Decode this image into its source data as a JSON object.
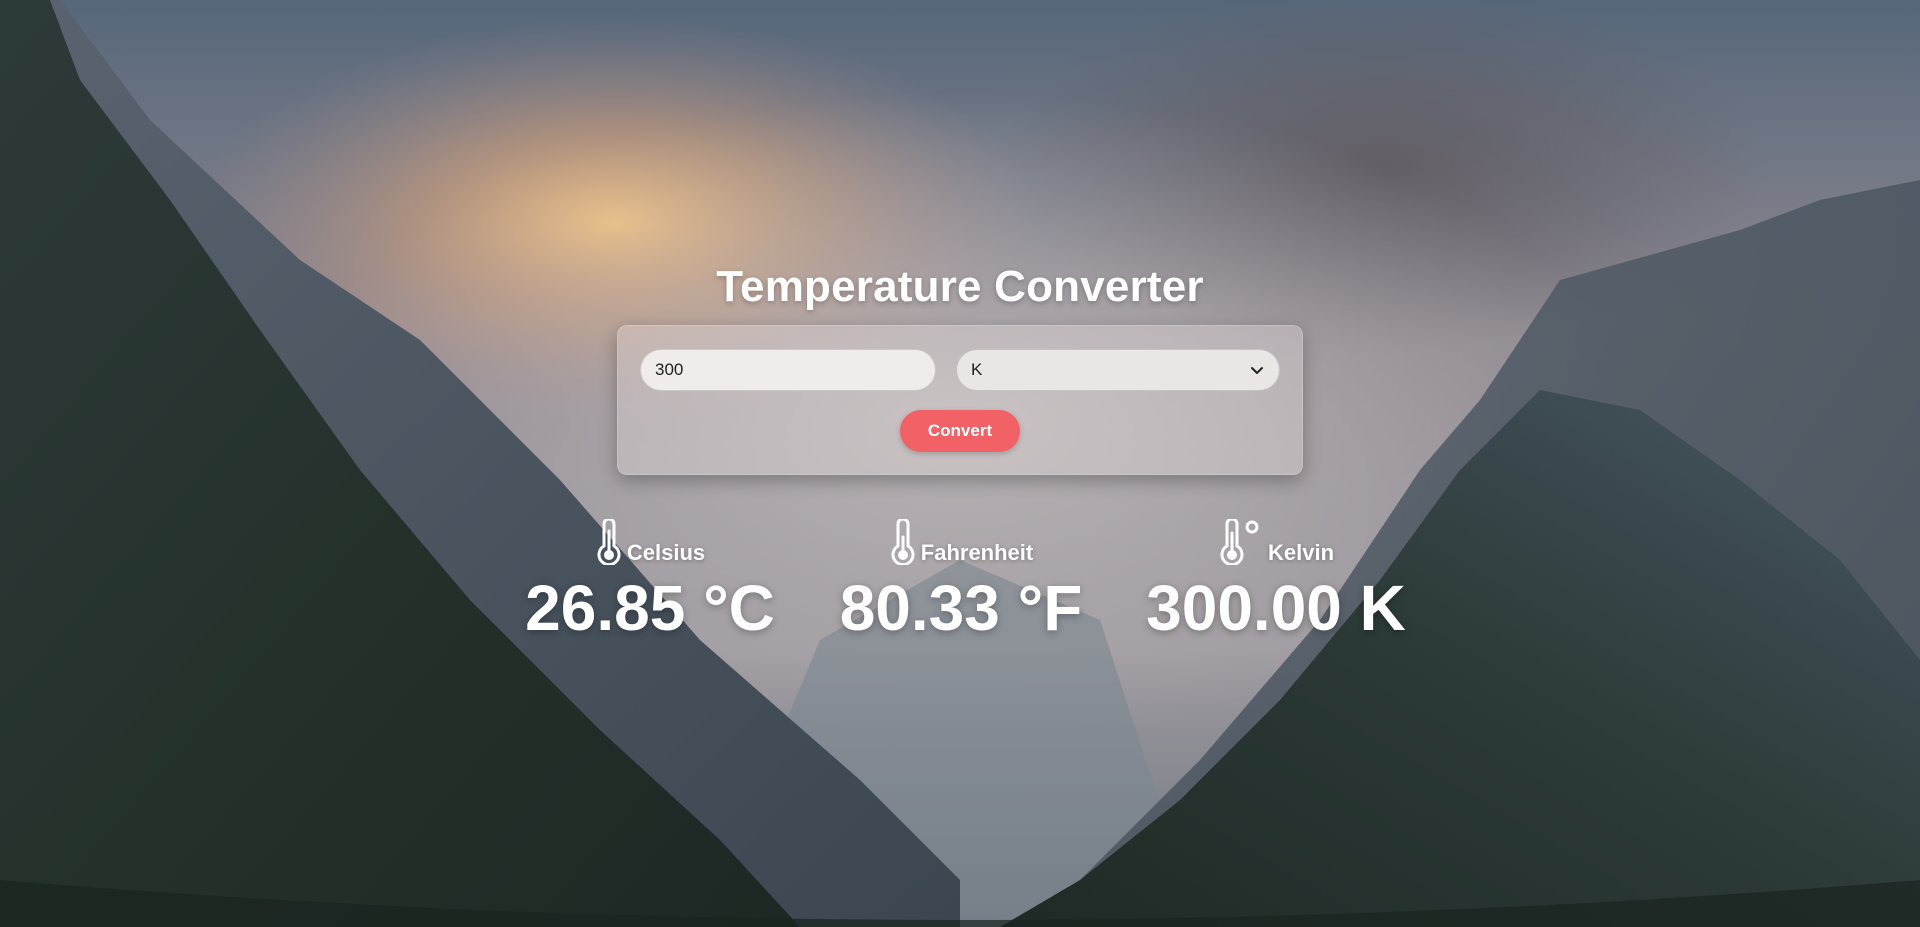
{
  "app": {
    "title": "Temperature Converter"
  },
  "form": {
    "input_value": "300",
    "unit_selected": "K",
    "unit_options": [
      "K"
    ],
    "convert_label": "Convert"
  },
  "results": {
    "celsius": {
      "label": "Celsius",
      "value": "26.85 °C",
      "icon": "thermometer-icon"
    },
    "fahrenheit": {
      "label": "Fahrenheit",
      "value": "80.33 °F",
      "icon": "thermometer-icon"
    },
    "kelvin": {
      "label": "Kelvin",
      "value": "300.00 K",
      "icon": "thermometer-degree-icon"
    }
  },
  "colors": {
    "accent": "#f26166",
    "text": "#ffffff"
  }
}
